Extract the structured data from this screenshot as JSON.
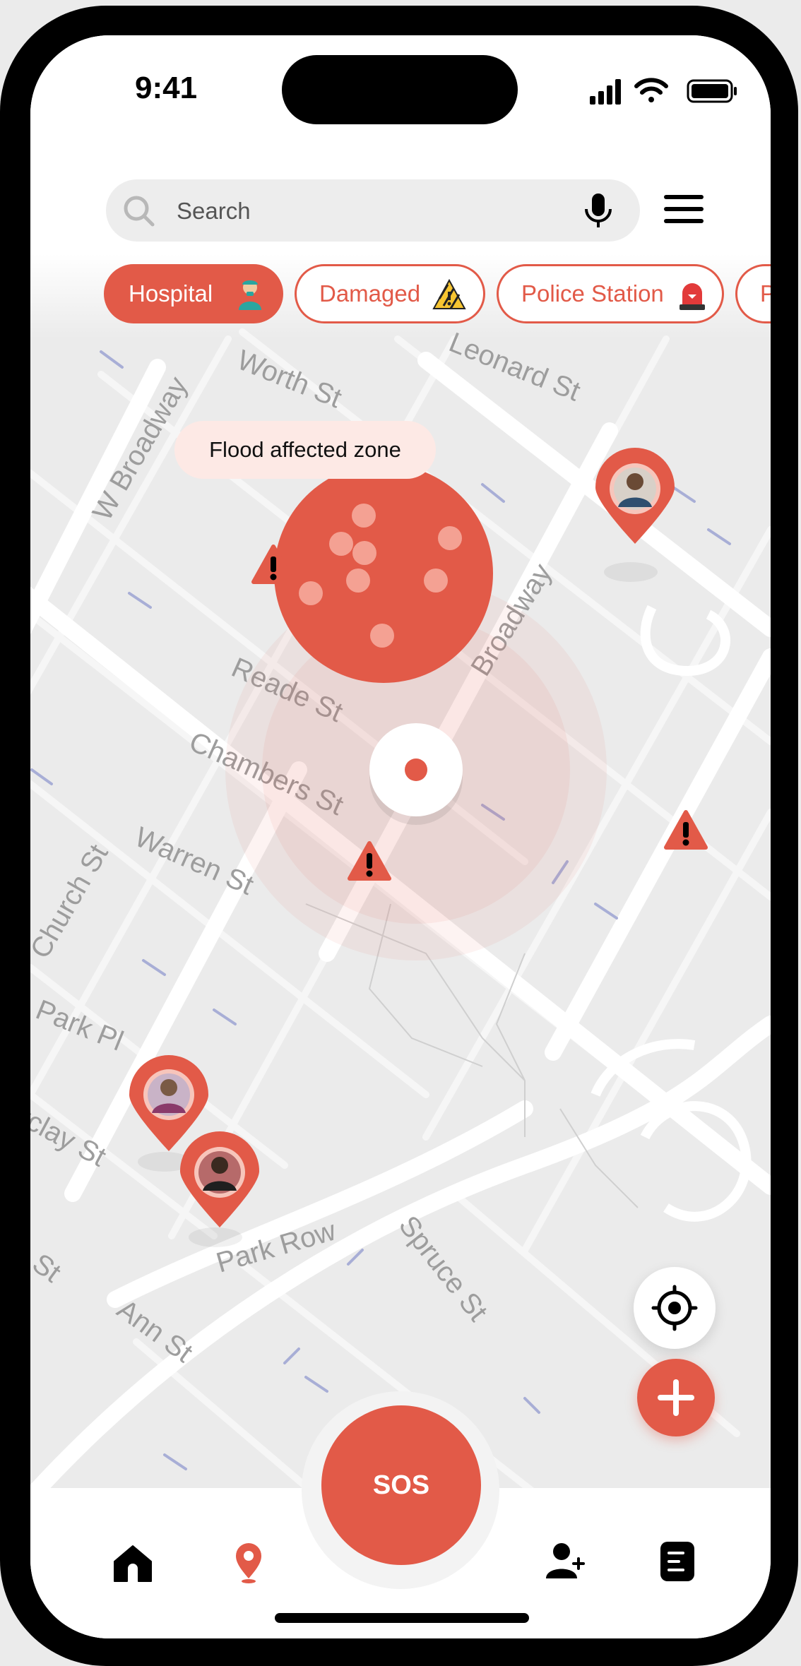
{
  "status_bar": {
    "time": "9:41"
  },
  "search": {
    "placeholder": "Search"
  },
  "filters": [
    {
      "label": "Hospital",
      "icon": "health-worker-icon",
      "active": true
    },
    {
      "label": "Damaged",
      "icon": "hazard-icon",
      "active": false
    },
    {
      "label": "Police Station",
      "icon": "siren-icon",
      "active": false
    },
    {
      "label": "Po",
      "icon": "",
      "active": false
    }
  ],
  "map": {
    "zone_label": "Flood affected zone",
    "streets": [
      "Worth St",
      "Leonard St",
      "W Broadway",
      "Broadway",
      "Reade St",
      "Chambers St",
      "Warren St",
      "Church St",
      "Park Pl",
      "rclay St",
      "Park Row",
      "Spruce St",
      "Ann St",
      "St",
      "W"
    ],
    "markers": [
      "user-pin",
      "user-pin",
      "user-pin",
      "warning",
      "warning",
      "warning",
      "current-location"
    ]
  },
  "tab_bar": {
    "sos_label": "SOS",
    "items": [
      "home",
      "map",
      "sos",
      "add-contact",
      "reports"
    ],
    "active": "map"
  },
  "colors": {
    "accent": "#e25a48",
    "accent_light": "#fde9e5",
    "map_bg": "#ebebeb",
    "road": "#ffffff"
  }
}
